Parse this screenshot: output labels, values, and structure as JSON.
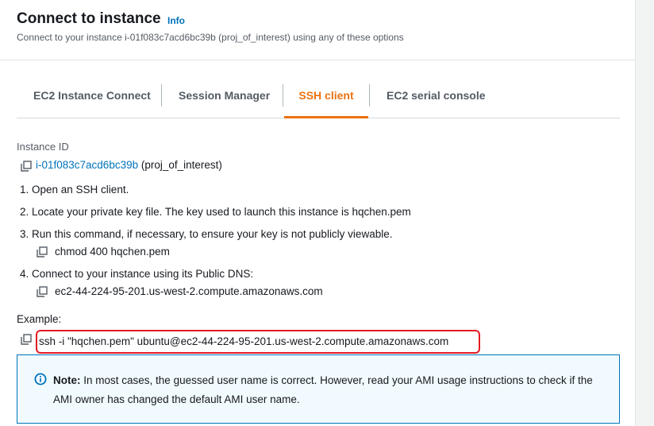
{
  "header": {
    "title": "Connect to instance",
    "info_label": "Info",
    "subtitle": "Connect to your instance i-01f083c7acd6bc39b (proj_of_interest) using any of these options"
  },
  "tabs": [
    {
      "label": "EC2 Instance Connect",
      "active": false
    },
    {
      "label": "Session Manager",
      "active": false
    },
    {
      "label": "SSH client",
      "active": true
    },
    {
      "label": "EC2 serial console",
      "active": false
    }
  ],
  "instance": {
    "label": "Instance ID",
    "id": "i-01f083c7acd6bc39b",
    "name": "(proj_of_interest)"
  },
  "steps": [
    {
      "text": "1. Open an SSH client."
    },
    {
      "text": "2. Locate your private key file. The key used to launch this instance is hqchen.pem"
    },
    {
      "text": "3. Run this command, if necessary, to ensure your key is not publicly viewable.",
      "command": "chmod 400 hqchen.pem"
    },
    {
      "text": "4. Connect to your instance using its Public DNS:",
      "command": "ec2-44-224-95-201.us-west-2.compute.amazonaws.com"
    }
  ],
  "example": {
    "label": "Example:",
    "command": "ssh -i \"hqchen.pem\" ubuntu@ec2-44-224-95-201.us-west-2.compute.amazonaws.com"
  },
  "note": {
    "title": "Note:",
    "text": "In most cases, the guessed user name is correct. However, read your AMI usage instructions to check if the AMI owner has changed the default AMI user name."
  },
  "colors": {
    "accent": "#ec7211",
    "link": "#0073bb",
    "highlight": "#e31b23",
    "note_bg": "#f1faff"
  },
  "icons": [
    "copy-icon",
    "info-icon"
  ]
}
